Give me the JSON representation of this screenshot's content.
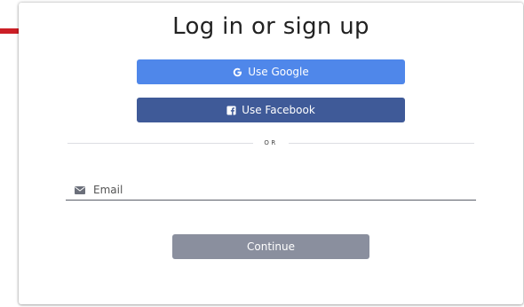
{
  "auth": {
    "title": "Log in or sign up",
    "google_label": "Use Google",
    "facebook_label": "Use Facebook",
    "divider_text": "OR",
    "email_placeholder": "Email",
    "email_value": "",
    "continue_label": "Continue"
  },
  "colors": {
    "google": "#4f87ea",
    "facebook": "#3f5a98",
    "continue_disabled": "#8a8f9e",
    "annotation_arrow": "#cc1f26"
  },
  "icons": {
    "google": "google-g-icon",
    "facebook": "facebook-f-icon",
    "email": "envelope-icon",
    "annotation": "red-arrow-icon"
  }
}
